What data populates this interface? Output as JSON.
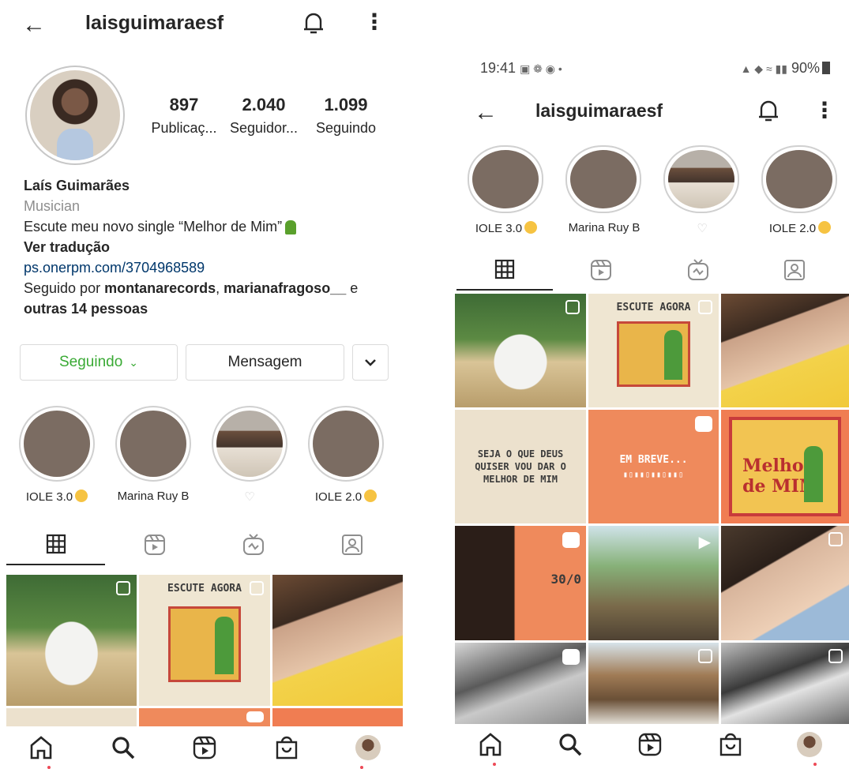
{
  "left": {
    "header": {
      "username": "laisguimaraesf"
    },
    "stats": [
      {
        "value": "897",
        "label": "Publicaç..."
      },
      {
        "value": "2.040",
        "label": "Seguidor..."
      },
      {
        "value": "1.099",
        "label": "Seguindo"
      }
    ],
    "bio": {
      "name": "Laís Guimarães",
      "category": "Musician",
      "text": "Escute meu novo single “Melhor de Mim”",
      "translate": "Ver tradução",
      "link": "ps.onerpm.com/3704968589",
      "followed_prefix": "Seguido por ",
      "followed_user1": "montanarecords",
      "followed_sep": ", ",
      "followed_user2": "marianafragoso__",
      "followed_and": " e",
      "followed_others": "outras 14 pessoas"
    },
    "buttons": {
      "following": "Seguindo",
      "message": "Mensagem"
    },
    "highlights": [
      "IOLE 3.0",
      "Marina Ruy B",
      "",
      "IOLE 2.0"
    ],
    "grid_texts": {
      "poster_title": "ESCUTE AGORA"
    }
  },
  "right": {
    "status": {
      "time": "19:41",
      "battery": "90%"
    },
    "header": {
      "username": "laisguimaraesf"
    },
    "highlights": [
      "IOLE 3.0",
      "Marina Ruy B",
      "",
      "IOLE 2.0"
    ],
    "grid_texts": {
      "poster_title": "ESCUTE AGORA",
      "quote": "SEJA O QUE DEUS QUISER VOU DAR O MELHOR DE MIM",
      "soon": "EM BREVE...",
      "poster2": "Melhor de MIM",
      "date": "30/0"
    }
  },
  "colors": {
    "accent_green": "#3aaa35",
    "link_blue": "#00376b",
    "notif_dot": "#ed4956"
  }
}
